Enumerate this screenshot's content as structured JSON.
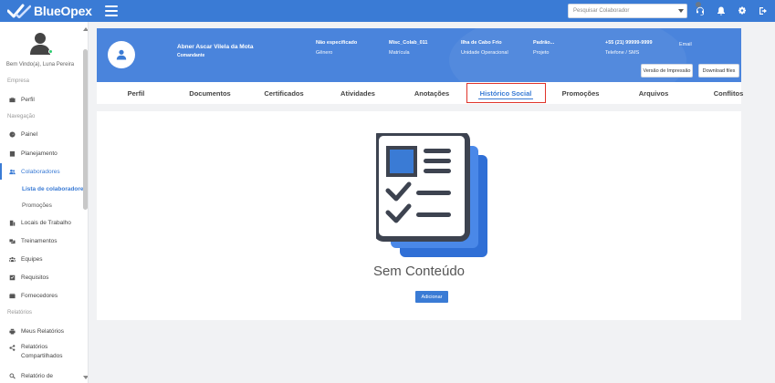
{
  "app": {
    "name": "BlueOpex"
  },
  "topbar": {
    "search_placeholder": "Pesquisar Colaborador",
    "icons": [
      "headset-icon",
      "bell-icon",
      "gear-icon",
      "logout-icon"
    ]
  },
  "sidebar": {
    "welcome": "Bem Vindo(a), Luna Pereira",
    "sections": {
      "empresa": "Empresa",
      "navegacao": "Navegação",
      "relatorios": "Relatórios"
    },
    "items": {
      "perfil": "Perfil",
      "painel": "Painel",
      "planejamento": "Planejamento",
      "colaboradores": "Colaboradores",
      "lista_colaboradores": "Lista de colaboradores",
      "promocoes": "Promoções",
      "locais": "Locais de Trabalho",
      "treinamentos": "Treinamentos",
      "equipes": "Equipes",
      "requisitos": "Requisitos",
      "fornecedores": "Fornecedores",
      "meus_relatorios": "Meus Relatórios",
      "relatorios_compartilhados_1": "Relatórios",
      "relatorios_compartilhados_2": "Compartilhados",
      "relatorio_de": "Relatório de"
    }
  },
  "profile": {
    "name": "Abner Ascar Vilela da Mota",
    "role": "Comandante",
    "fields": [
      {
        "value": "Não especificado",
        "label": "Gênero"
      },
      {
        "value": "Misc_Colab_011",
        "label": "Matrícula"
      },
      {
        "value": "Ilha de Cabo Frio",
        "label": "Unidade Operacional"
      },
      {
        "value": "Padrão...",
        "label": "Projeto"
      },
      {
        "value": "+55 (21) 99999-9999",
        "label": "Telefone / SMS"
      },
      {
        "value": "Email",
        "label": ""
      }
    ],
    "print_button": "Versão de Impressão",
    "download_button": "Download files"
  },
  "tabs": [
    "Perfil",
    "Documentos",
    "Certificados",
    "Atividades",
    "Anotações",
    "Histórico Social",
    "Promoções",
    "Arquivos",
    "Conflitos"
  ],
  "active_tab": "Histórico Social",
  "empty_state": {
    "title": "Sem Conteúdo",
    "add_button": "Adicionar"
  },
  "colors": {
    "primary": "#3a7bd5",
    "banner": "#4a84dc",
    "highlight": "#e0342a",
    "online": "#2ecc71"
  }
}
